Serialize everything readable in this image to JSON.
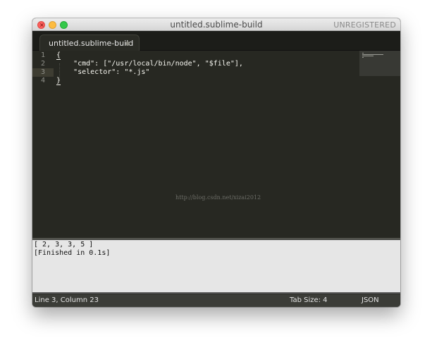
{
  "window": {
    "title": "untitled.sublime-build",
    "license_status": "UNREGISTERED"
  },
  "tab": {
    "label": "untitled.sublime-build",
    "modified_indicator": "dot-icon"
  },
  "editor": {
    "line_numbers": [
      "1",
      "2",
      "3",
      "4"
    ],
    "lines": [
      "{",
      "    \"cmd\": [\"/usr/local/bin/node\", \"$file\"],",
      "    \"selector\": \"*.js\"",
      "}"
    ],
    "watermark": "http://blog.csdn.net/xizai2012"
  },
  "output": {
    "lines": [
      "[ 2, 3, 3, 5 ]",
      "[Finished in 0.1s]"
    ]
  },
  "status_bar": {
    "position": "Line 3, Column 23",
    "tab_size": "Tab Size: 4",
    "syntax": "JSON"
  },
  "colors": {
    "editor_background": "#272822",
    "output_background": "#e6e6e6",
    "status_background": "#3b3c37"
  }
}
